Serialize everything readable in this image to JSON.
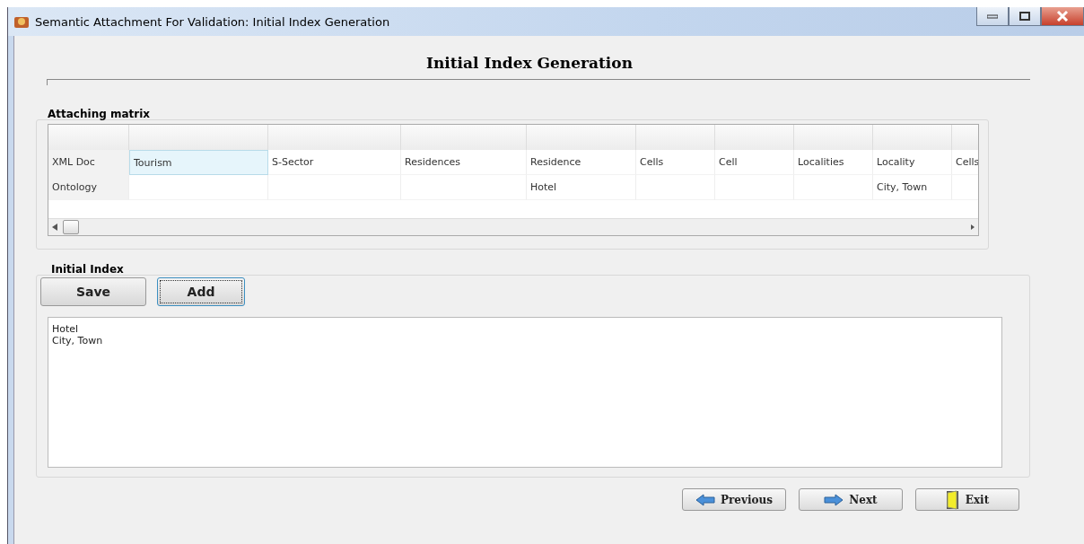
{
  "window": {
    "title": "Semantic Attachment For Validation: Initial Index Generation"
  },
  "heading": "Initial Index Generation",
  "matrix": {
    "title": "Attaching matrix",
    "rows": [
      {
        "header": "XML Doc",
        "cells": [
          {
            "text": "Tourism",
            "selected": true
          },
          {
            "text": "S-Sector",
            "selected": false
          },
          {
            "text": "Residences",
            "selected": false
          },
          {
            "text": "Residence",
            "selected": false
          },
          {
            "text": "Cells",
            "selected": false
          },
          {
            "text": "Cell",
            "selected": false
          },
          {
            "text": "Localities",
            "selected": false
          },
          {
            "text": "Locality",
            "selected": false
          },
          {
            "text": "Cells",
            "selected": false
          }
        ]
      },
      {
        "header": "Ontology",
        "cells": [
          {
            "selected": false
          },
          {
            "selected": false
          },
          {
            "selected": false
          },
          {
            "text": "Hotel",
            "selected": false
          },
          {
            "selected": false
          },
          {
            "selected": false
          },
          {
            "selected": false
          },
          {
            "text": "City, Town",
            "selected": false
          },
          {
            "selected": false
          }
        ]
      }
    ]
  },
  "index": {
    "title": "Initial Index",
    "buttons": [
      {
        "label": "Save",
        "focused": false
      },
      {
        "label": "Add",
        "focused": true
      }
    ],
    "lines": [
      "Hotel",
      "City, Town"
    ]
  },
  "nav": [
    {
      "kind": "previous",
      "label": "Previous"
    },
    {
      "kind": "next",
      "label": "Next"
    },
    {
      "kind": "exit",
      "label": "Exit"
    }
  ]
}
